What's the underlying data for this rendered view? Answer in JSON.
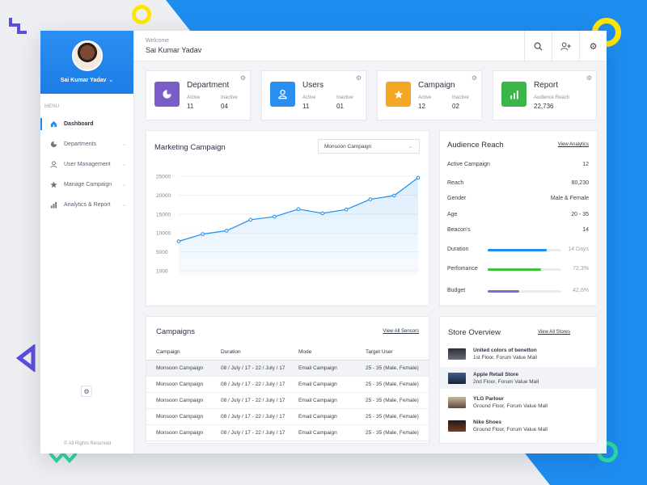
{
  "colors": {
    "accent": "#1e8df0",
    "department": "#7a5dc9",
    "users": "#2b8ff1",
    "campaign": "#f5a623",
    "report": "#3cb54a",
    "chart_line": "#1e8df0",
    "bar_duration": "#1e8df0",
    "bar_performance": "#3cc43c",
    "bar_budget": "#7a6cd6"
  },
  "sidebar": {
    "user_name": "Sai Kumar Yadav",
    "menu_title": "MENU",
    "items": [
      {
        "label": "Dashboard",
        "icon": "home-icon",
        "active": true
      },
      {
        "label": "Departments",
        "icon": "pie-icon",
        "active": false
      },
      {
        "label": "User Management",
        "icon": "user-icon",
        "active": false
      },
      {
        "label": "Manage Campaign",
        "icon": "star-icon",
        "active": false
      },
      {
        "label": "Analytics & Report",
        "icon": "chart-icon",
        "active": false
      }
    ],
    "copyright": "© All Rights Reserved"
  },
  "header": {
    "welcome_label": "Welcome",
    "user_name": "Sai Kumar Yadav",
    "actions": [
      "search-icon",
      "add-user-icon",
      "gear-icon"
    ]
  },
  "stats": {
    "department": {
      "title": "Department",
      "col1_label": "Active",
      "col1_value": "11",
      "col2_label": "Inactive",
      "col2_value": "04"
    },
    "users": {
      "title": "Users",
      "col1_label": "Active",
      "col1_value": "11",
      "col2_label": "Inactive",
      "col2_value": "01"
    },
    "campaign": {
      "title": "Campaign",
      "col1_label": "Active",
      "col1_value": "12",
      "col2_label": "Inactive",
      "col2_value": "02"
    },
    "report": {
      "title": "Report",
      "col1_label": "Audience Reach",
      "col1_value": "22,736"
    }
  },
  "marketing": {
    "title": "Marketing Campaign",
    "select_value": "Monsoon Campaign"
  },
  "chart_data": {
    "type": "area",
    "title": "",
    "xlabel": "",
    "ylabel": "",
    "y_tick_labels": [
      "25000",
      "20000",
      "15000",
      "10000",
      "5000",
      "1000"
    ],
    "ylim": [
      0,
      25000
    ],
    "x": [
      1,
      2,
      3,
      4,
      5,
      6,
      7,
      8,
      9,
      10,
      11
    ],
    "series": [
      {
        "values": [
          7800,
          9700,
          10600,
          13500,
          14300,
          16300,
          15200,
          16200,
          18900,
          19900,
          24600
        ]
      }
    ],
    "grid": true
  },
  "audience": {
    "title": "Audience Reach",
    "link": "View Analytics",
    "rows": [
      {
        "label": "Active Campaign",
        "value": "12"
      },
      {
        "label": "Reach",
        "value": "80,230"
      },
      {
        "label": "Gender",
        "value": "Male & Female"
      },
      {
        "label": "Age",
        "value": "20 - 35"
      },
      {
        "label": "Beacon's",
        "value": "14"
      }
    ],
    "bars": [
      {
        "label": "Duration",
        "value_text": "14 Days",
        "fraction": 0.8
      },
      {
        "label": "Perfomance",
        "value_text": "72,3%",
        "fraction": 0.723
      },
      {
        "label": "Budget",
        "value_text": "42,6%",
        "fraction": 0.426
      }
    ]
  },
  "campaigns": {
    "title": "Campaigns",
    "link": "View All Sensors",
    "columns": [
      "Campaign",
      "Duration",
      "Mode",
      "Target User"
    ],
    "rows": [
      [
        "Monsoon Campaign",
        "08 / July / 17 - 22 / July / 17",
        "Email Campaign",
        "25 - 35 (Male, Female)"
      ],
      [
        "Monsoon Campaign",
        "08 / July / 17 - 22 / July / 17",
        "Email Campaign",
        "25 - 35 (Male, Female)"
      ],
      [
        "Monsoon Campaign",
        "08 / July / 17 - 22 / July / 17",
        "Email Campaign",
        "25 - 35 (Male, Female)"
      ],
      [
        "Monsoon Campaign",
        "08 / July / 17 - 22 / July / 17",
        "Email Campaign",
        "25 - 35 (Male, Female)"
      ],
      [
        "Monsoon Campaign",
        "08 / July / 17 - 22 / July / 17",
        "Email Campaign",
        "25 - 35 (Male, Female)"
      ]
    ]
  },
  "stores": {
    "title": "Store Overview",
    "link": "View All Stores",
    "items": [
      {
        "name": "United colors of benetton",
        "address": "1st Floor, Forum Value Mall"
      },
      {
        "name": "Apple Retail Store",
        "address": "2nd Floor, Forum Value Mall"
      },
      {
        "name": "YLG Parlour",
        "address": "Ground Floor, Forum Value Mall"
      },
      {
        "name": "Nike Shoes",
        "address": "Ground Floor, Forum Value Mall"
      }
    ]
  }
}
